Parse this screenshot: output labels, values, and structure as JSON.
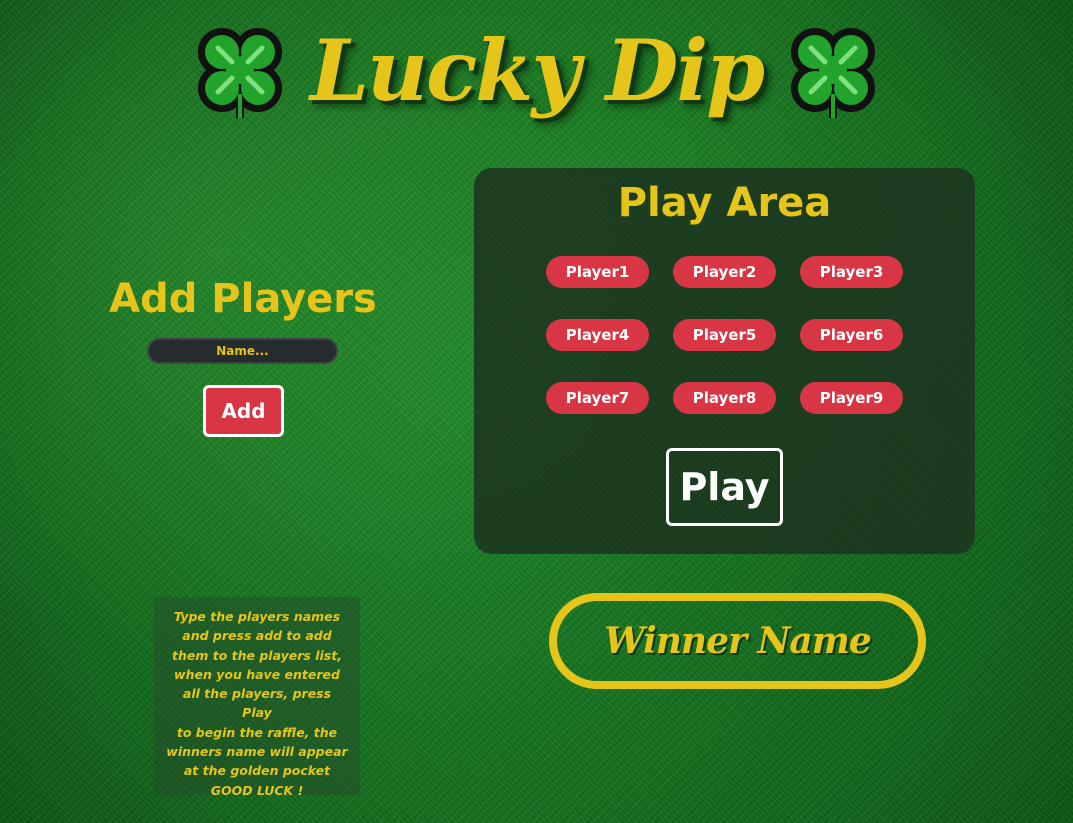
{
  "header": {
    "title": "Lucky Dip",
    "left_icon": "four-leaf-clover",
    "right_icon": "four-leaf-clover"
  },
  "add_players": {
    "title": "Add Players",
    "name_placeholder": "Name...",
    "add_label": "Add"
  },
  "help": {
    "lines": [
      "Type the players names",
      "and press add to add",
      "them to the players list,",
      "when you have entered",
      "all the players, press Play",
      "to begin the raffle, the",
      "winners name will appear",
      "at the golden pocket",
      "GOOD LUCK !"
    ]
  },
  "play_area": {
    "title": "Play Area",
    "players": [
      "Player1",
      "Player2",
      "Player3",
      "Player4",
      "Player5",
      "Player6",
      "Player7",
      "Player8",
      "Player9"
    ],
    "play_label": "Play"
  },
  "winner": {
    "text": "Winner Name"
  },
  "colors": {
    "gold": "#e6c51a",
    "red": "#d83545",
    "felt_green": "#1f8a2a",
    "panel": "#1c3420"
  }
}
